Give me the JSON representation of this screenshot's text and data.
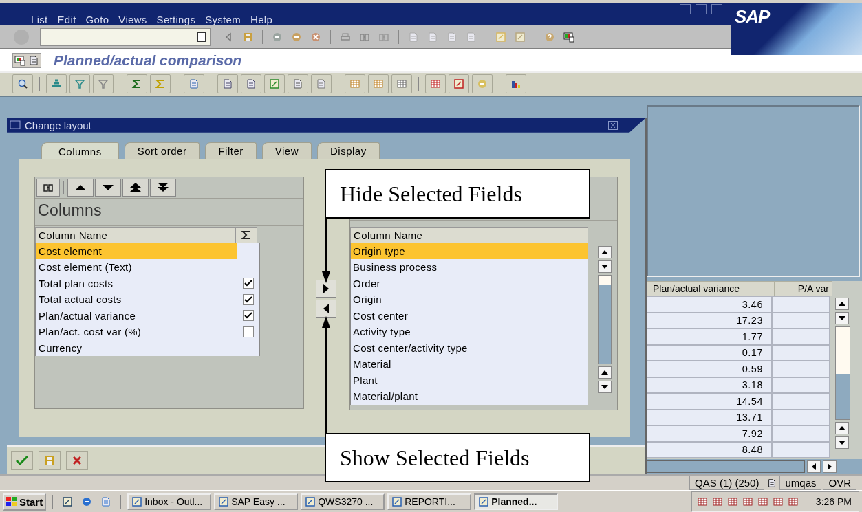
{
  "menu_bar": {
    "items": [
      "List",
      "Edit",
      "Goto",
      "Views",
      "Settings",
      "System",
      "Help"
    ],
    "logo": "SAP"
  },
  "screen_title": "Planned/actual comparison",
  "list": {
    "columns": [
      "Plan/actual variance",
      "P/A var"
    ],
    "rows": [
      "3.46",
      "17.23",
      "1.77",
      "0.17",
      "0.59",
      "3.18",
      "14.54",
      "13.71",
      "7.92",
      "8.48"
    ]
  },
  "dialog": {
    "title": "Change layout",
    "tabs": [
      {
        "label": "Columns",
        "selected": true
      },
      {
        "label": "Sort order",
        "selected": false
      },
      {
        "label": "Filter",
        "selected": false
      },
      {
        "label": "View",
        "selected": false
      },
      {
        "label": "Display",
        "selected": false
      }
    ],
    "left_panel": {
      "title": "Columns",
      "header": "Column Name",
      "rows": [
        {
          "name": "Cost element",
          "selected": true,
          "kind": "plain"
        },
        {
          "name": "Cost element (Text)",
          "selected": false,
          "kind": "plain"
        },
        {
          "name": "Total plan costs",
          "selected": false,
          "kind": "checkbox",
          "checked": true
        },
        {
          "name": "Total actual costs",
          "selected": false,
          "kind": "checkbox",
          "checked": true
        },
        {
          "name": "Plan/actual variance",
          "selected": false,
          "kind": "checkbox",
          "checked": true
        },
        {
          "name": "Plan/act. cost var (%)",
          "selected": false,
          "kind": "checkbox",
          "checked": false
        },
        {
          "name": "Currency",
          "selected": false,
          "kind": "plain"
        }
      ]
    },
    "right_panel": {
      "header": "Column Name",
      "rows": [
        {
          "name": "Origin type",
          "selected": true
        },
        {
          "name": "Business process",
          "selected": false
        },
        {
          "name": "Order",
          "selected": false
        },
        {
          "name": "Origin",
          "selected": false
        },
        {
          "name": "Cost center",
          "selected": false
        },
        {
          "name": "Activity type",
          "selected": false
        },
        {
          "name": "Cost center/activity type",
          "selected": false
        },
        {
          "name": "Material",
          "selected": false
        },
        {
          "name": "Plant",
          "selected": false
        },
        {
          "name": "Material/plant",
          "selected": false
        }
      ]
    }
  },
  "callouts": [
    "Hide Selected Fields",
    "Show Selected Fields"
  ],
  "status_bar": {
    "system": "QAS (1) (250)",
    "user": "umqas",
    "mode": "OVR"
  },
  "taskbar": {
    "start": "Start",
    "tasks": [
      {
        "label": "Inbox - Outl...",
        "selected": false
      },
      {
        "label": "SAP Easy ...",
        "selected": false
      },
      {
        "label": "QWS3270 ...",
        "selected": false
      },
      {
        "label": "REPORTI...",
        "selected": false
      },
      {
        "label": "Planned...",
        "selected": true
      }
    ],
    "clock": "3:26 PM"
  }
}
